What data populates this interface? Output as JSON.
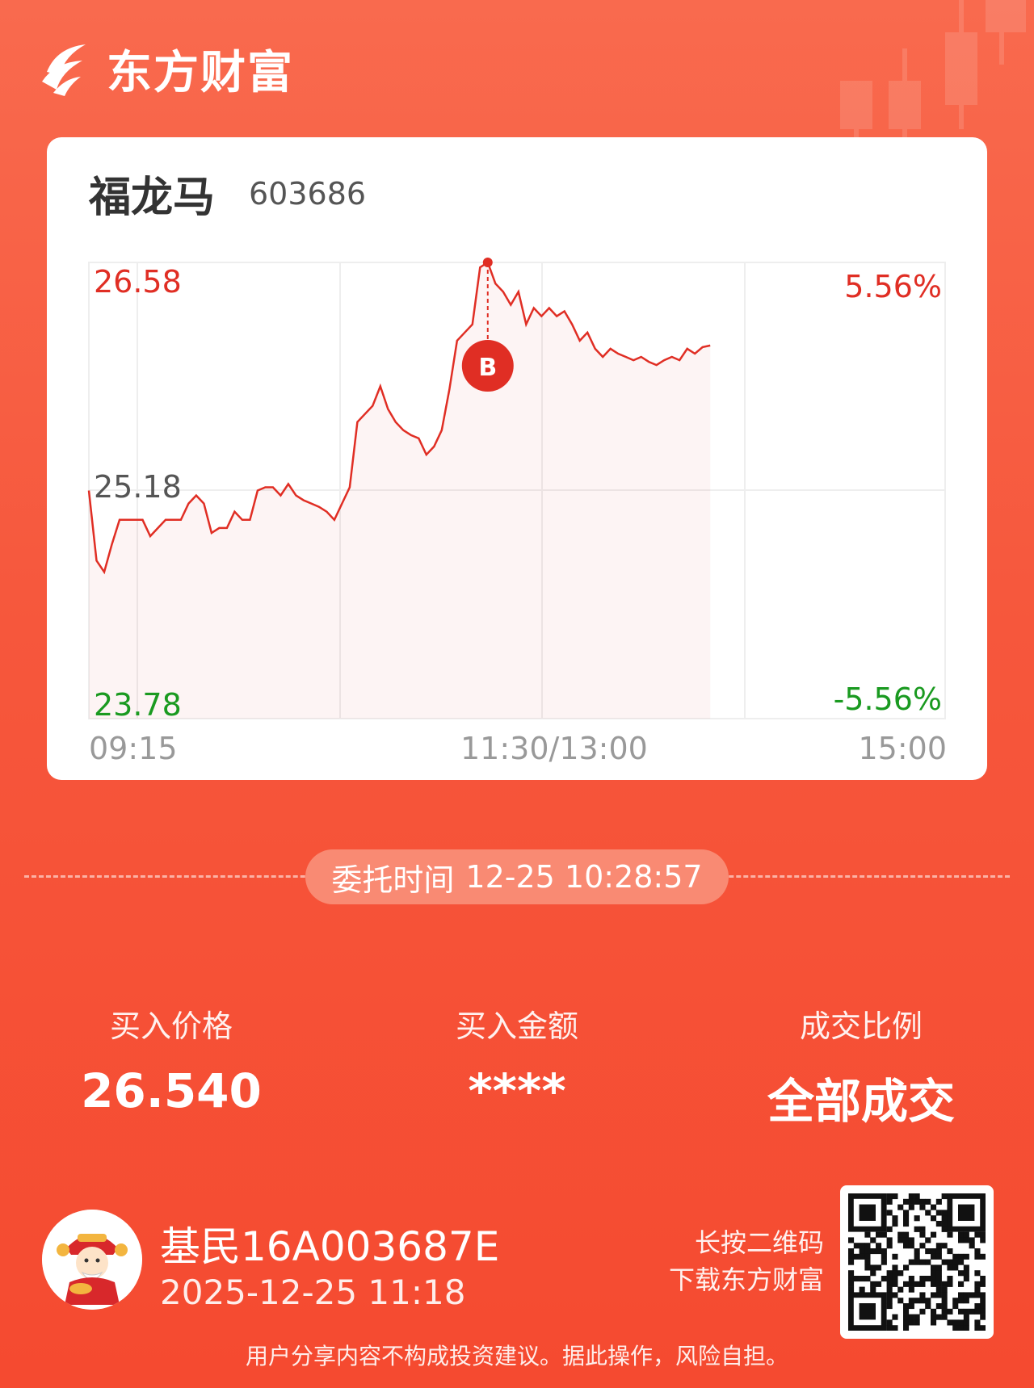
{
  "brand": {
    "name": "东方财富"
  },
  "stock": {
    "name": "福龙马",
    "code": "603686"
  },
  "chart_data": {
    "type": "line",
    "price_high": "26.58",
    "price_mid": "25.18",
    "price_low": "23.78",
    "pct_high": "5.56%",
    "pct_low": "-5.56%",
    "time_start": "09:15",
    "time_mid": "11:30/13:00",
    "time_end": "15:00",
    "ylim": [
      23.78,
      26.58
    ],
    "series": [
      {
        "values": [
          25.18,
          24.75,
          24.68,
          24.85,
          25.0,
          25.0,
          25.0,
          25.0,
          24.9,
          24.95,
          25.0,
          25.0,
          25.0,
          25.1,
          25.15,
          25.1,
          24.92,
          24.95,
          24.95,
          25.05,
          25.0,
          25.0,
          25.18,
          25.2,
          25.2,
          25.15,
          25.22,
          25.15,
          25.12,
          25.1,
          25.08,
          25.05,
          25.0,
          25.1,
          25.2,
          25.6,
          25.65,
          25.7,
          25.82,
          25.68,
          25.6,
          25.55,
          25.52,
          25.5,
          25.4,
          25.45,
          25.55,
          25.8,
          26.1,
          26.15,
          26.2,
          26.55,
          26.58,
          26.45,
          26.4,
          26.32,
          26.4,
          26.2,
          26.3,
          26.25,
          26.3,
          26.25,
          26.28,
          26.2,
          26.1,
          26.15,
          26.05,
          26.0,
          26.05,
          26.02,
          26.0,
          25.98,
          26.0,
          25.97,
          25.95,
          25.98,
          26.0,
          25.98,
          26.05,
          26.02,
          26.06,
          26.07
        ]
      }
    ],
    "buy_marker": {
      "label": "B",
      "value": 26.58
    }
  },
  "order": {
    "label": "委托时间",
    "time": "12-25 10:28:57"
  },
  "stats": [
    {
      "label": "买入价格",
      "value": "26.540"
    },
    {
      "label": "买入金额",
      "value": "****"
    },
    {
      "label": "成交比例",
      "value": "全部成交"
    }
  ],
  "user": {
    "name": "基民16A003687E",
    "time": "2025-12-25 11:18"
  },
  "qr": {
    "line1": "长按二维码",
    "line2": "下载东方财富"
  },
  "disclaimer": "用户分享内容不构成投资建议。据此操作，风险自担。",
  "colors": {
    "up": "#e02e24",
    "down": "#1a9a20",
    "background": "#f6573c"
  }
}
